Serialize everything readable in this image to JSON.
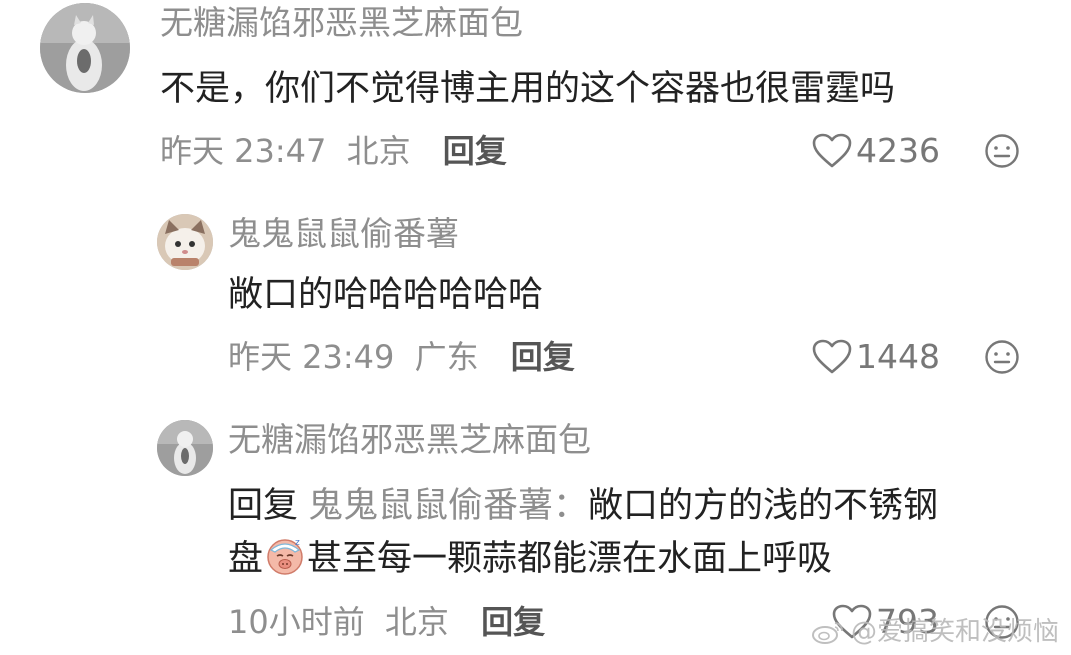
{
  "comments": [
    {
      "username": "无糖漏馅邪恶黑芝麻面包",
      "text": "不是，你们不觉得博主用的这个容器也很雷霆吗",
      "time": "昨天 23:47",
      "location": "北京",
      "reply_label": "回复",
      "likes": "4236"
    },
    {
      "username": "鬼鬼鼠鼠偷番薯",
      "text": "敞口的哈哈哈哈哈哈",
      "time": "昨天 23:49",
      "location": "广东",
      "reply_label": "回复",
      "likes": "1448"
    },
    {
      "username": "无糖漏馅邪恶黑芝麻面包",
      "reply_prefix": "回复",
      "mention": "鬼鬼鼠鼠偷番薯：",
      "text_line1": "敞口的方的浅的不锈钢",
      "text_line2_before": "盘",
      "text_line2_after": "甚至每一颗蒜都能漂在水面上呼吸",
      "time": "10小时前",
      "location": "北京",
      "reply_label": "回复",
      "likes": "793"
    }
  ],
  "watermark": "@爱搞笑和没烦恼",
  "icons": {
    "like": "heart-outline-icon",
    "more": "ellipsis-face-icon",
    "emoji": "sleepy-pig-emoji-icon"
  }
}
